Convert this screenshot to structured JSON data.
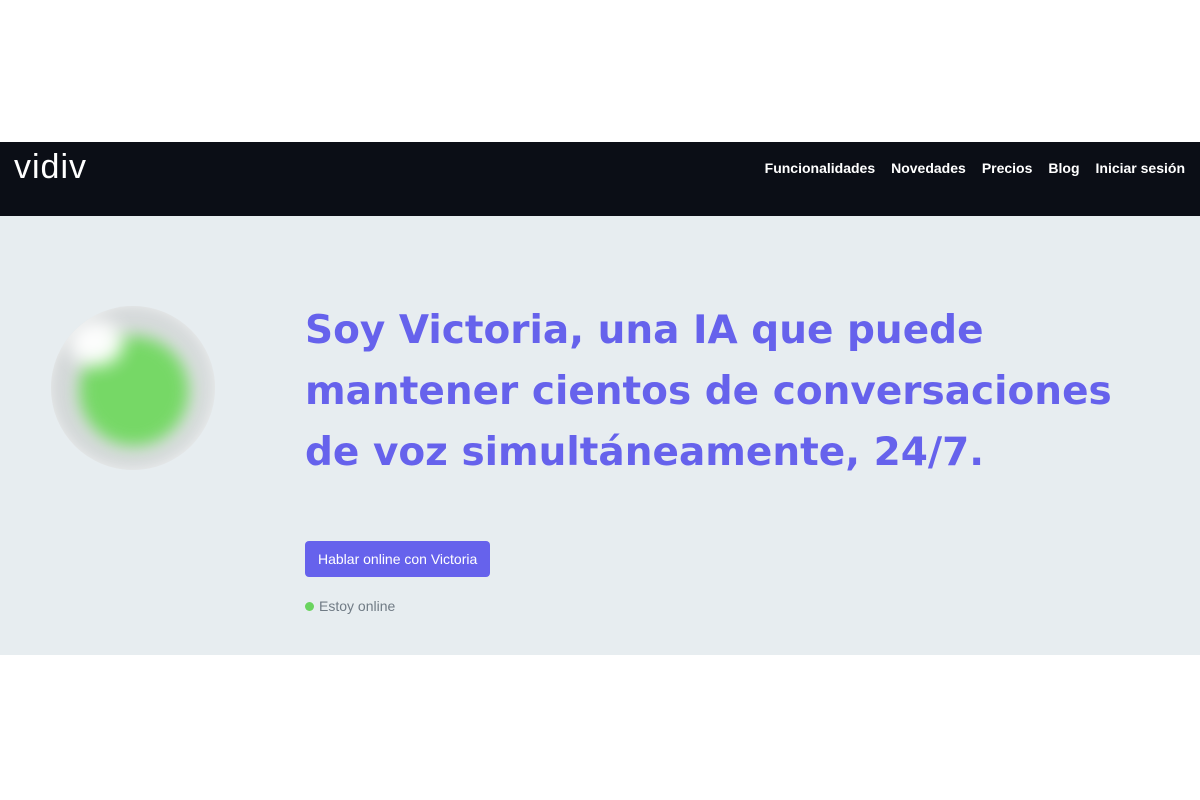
{
  "brand": {
    "logo_text": "vidiv"
  },
  "nav": {
    "items": [
      {
        "label": "Funcionalidades"
      },
      {
        "label": "Novedades"
      },
      {
        "label": "Precios"
      },
      {
        "label": "Blog"
      },
      {
        "label": "Iniciar sesión"
      }
    ]
  },
  "hero": {
    "headline": "Soy Victoria, una IA que puede mantener cientos de conversaciones de voz simultáneamente, 24/7.",
    "cta_label": "Hablar online con Victoria",
    "status_text": "Estoy online",
    "status_color": "#6ad45f",
    "orb_color": "#76d866"
  },
  "colors": {
    "navbar_bg": "#0b0e16",
    "hero_bg": "#e7edf0",
    "accent": "#6662ec"
  }
}
